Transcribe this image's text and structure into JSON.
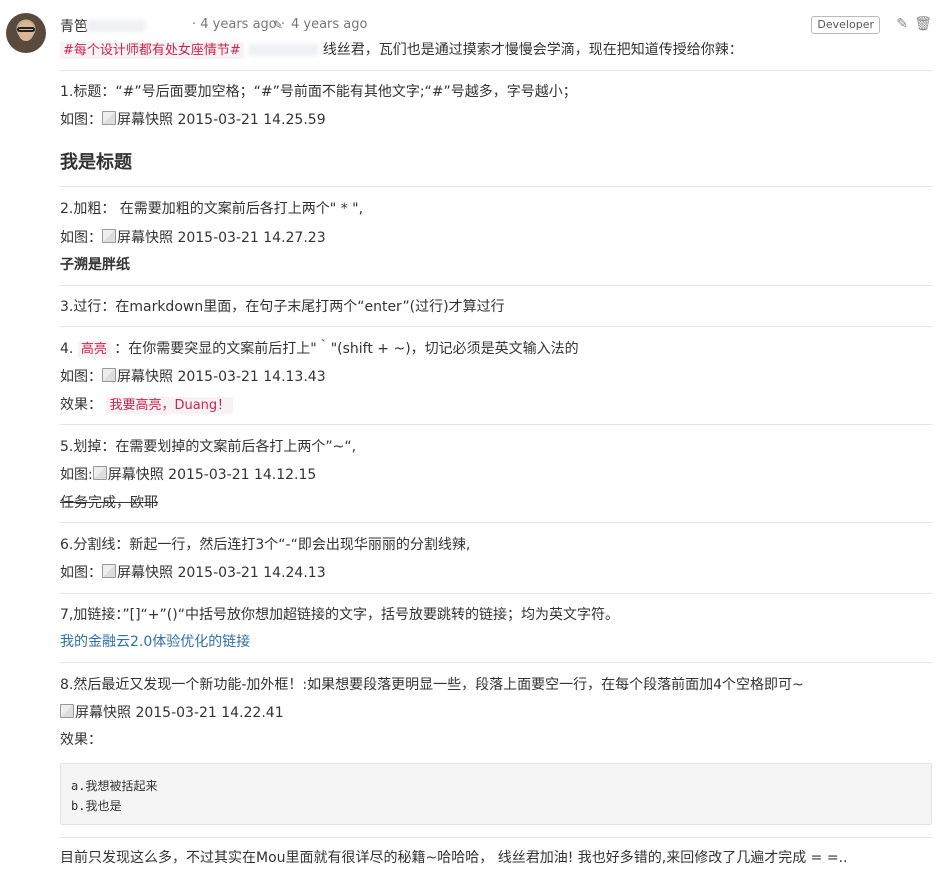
{
  "comment": {
    "author": "青笆",
    "time_created": "4 years ago",
    "separator": "·",
    "time_edited": "4 years ago",
    "role_badge": "Developer",
    "edit_icon": "pencil-square-icon",
    "delete_icon": "trash-icon"
  },
  "body": {
    "intro_tag": "#每个设计师都有处女座情节#",
    "intro_text": "线丝君，瓦们也是通过摸索才慢慢会学滴，现在把知道传授给你辣：",
    "s1_line": "1.标题：“#”号后面要加空格；“#”号前面不能有其他文字;“#”号越多，字号越小；",
    "s1_fig_label": "如图：",
    "s1_fig_alt": "屏幕快照 2015-03-21 14.25.59",
    "s1_heading": "我是标题",
    "s2_line": "2.加粗： 在需要加粗的文案前后各打上两个\" * \",",
    "s2_fig_label": "如图：",
    "s2_fig_alt": "屏幕快照 2015-03-21 14.27.23",
    "s2_bold": "子溯是胖纸",
    "s3_line": "3.过行：在markdown里面，在句子末尾打两个“enter”(过行)才算过行",
    "s4_prefix": "4.",
    "s4_tag": "高亮",
    "s4_rest": "：在你需要突显的文案前后打上\"｀\"(shift + ~)，切记必须是英文输入法的",
    "s4_fig_label": "如图：",
    "s4_fig_alt": "屏幕快照 2015-03-21 14.13.43",
    "s4_effect_label": "效果：",
    "s4_effect_tag": "我要高亮，Duang！",
    "s5_line": "5.划掉：在需要划掉的文案前后各打上两个”~“,",
    "s5_fig_label": "如图:",
    "s5_fig_alt": "屏幕快照 2015-03-21 14.12.15",
    "s5_strike": "任务完成，欧耶",
    "s6_line": "6.分割线：新起一行，然后连打3个“-“即会出现华丽丽的分割线辣,",
    "s6_fig_label": "如图：",
    "s6_fig_alt": "屏幕快照 2015-03-21 14.24.13",
    "s7_line": "7,加链接：”[]“+”()“中括号放你想加超链接的文字，括号放要跳转的链接；均为英文字符。",
    "s7_link": "我的金融云2.0体验优化的链接",
    "s8_line": "8.然后最近又发现一个新功能-加外框！:如果想要段落更明显一些，段落上面要空一行，在每个段落前面加4个空格即可~",
    "s8_fig_alt": "屏幕快照 2015-03-21 14.22.41",
    "s8_effect_label": "效果：",
    "code_line_a": "a.我想被括起来",
    "code_line_b": "b.我也是",
    "outro": "目前只发现这么多，不过其实在Mou里面就有很详尽的秘籍~哈哈哈， 线丝君加油! 我也好多错的,来回修改了几遍才完成 = =.."
  }
}
